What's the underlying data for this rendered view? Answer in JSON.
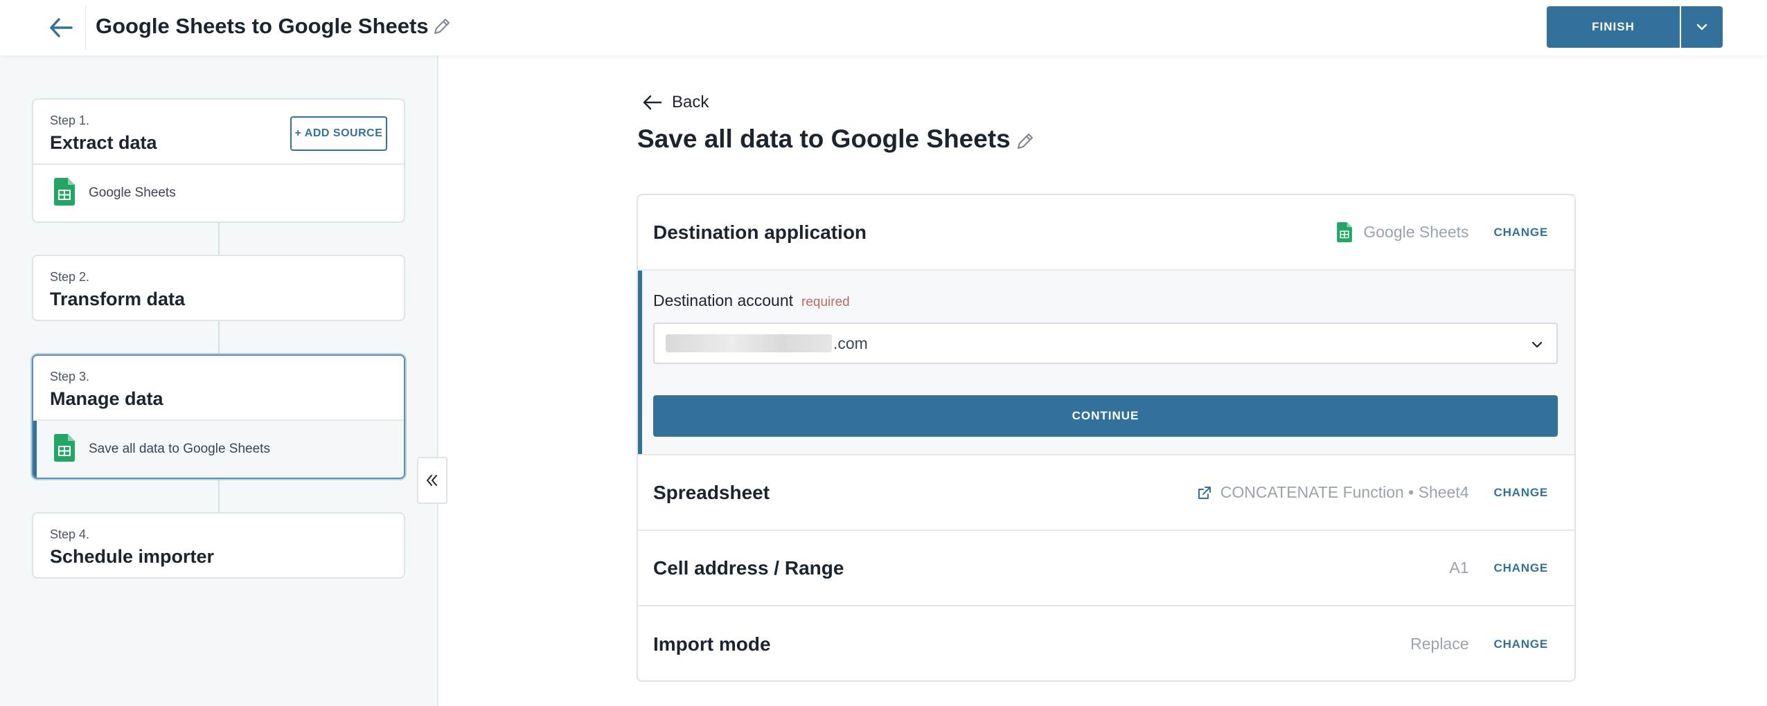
{
  "header": {
    "title": "Google Sheets to Google Sheets",
    "finish_label": "FINISH"
  },
  "sidebar": {
    "steps": [
      {
        "number": "Step 1.",
        "name": "Extract data",
        "action_label": "+ ADD SOURCE",
        "items": [
          "Google Sheets"
        ]
      },
      {
        "number": "Step 2.",
        "name": "Transform data",
        "items": []
      },
      {
        "number": "Step 3.",
        "name": "Manage data",
        "items": [
          "Save all data to Google Sheets"
        ]
      },
      {
        "number": "Step 4.",
        "name": "Schedule importer",
        "items": []
      }
    ]
  },
  "main": {
    "back_label": "Back",
    "title": "Save all data to Google Sheets",
    "destination": {
      "label": "Destination application",
      "value": "Google Sheets",
      "change_label": "CHANGE"
    },
    "account": {
      "label": "Destination account",
      "required_label": "required",
      "selected_domain": ".com",
      "continue_label": "CONTINUE"
    },
    "spreadsheet": {
      "label": "Spreadsheet",
      "value": "CONCATENATE Function • Sheet4",
      "change_label": "CHANGE"
    },
    "cell_range": {
      "label": "Cell address / Range",
      "value": "A1",
      "change_label": "CHANGE"
    },
    "import_mode": {
      "label": "Import mode",
      "value": "Replace",
      "change_label": "CHANGE"
    }
  },
  "colors": {
    "accent": "#32729a",
    "required": "#c06a5a",
    "sheets_green": "#23a566"
  }
}
